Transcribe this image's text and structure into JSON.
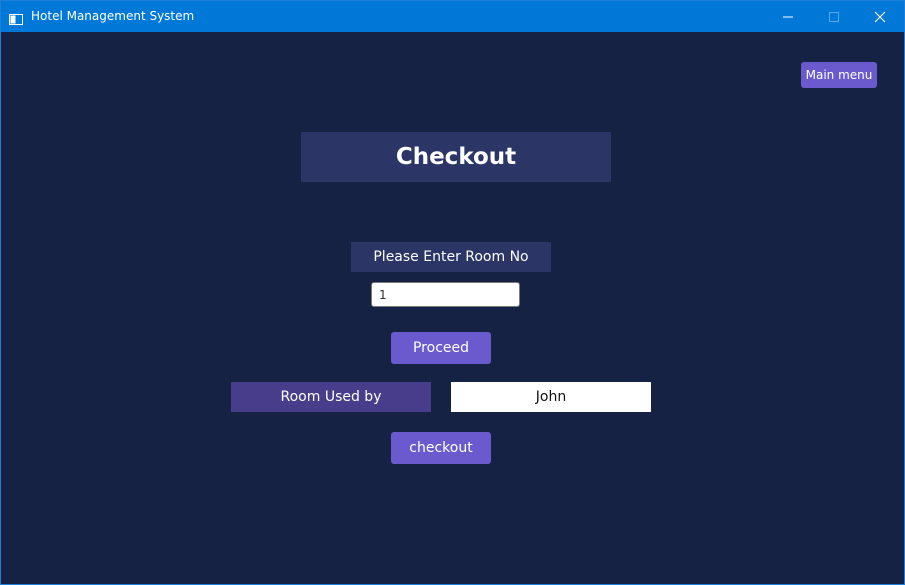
{
  "window": {
    "title": "Hotel Management System",
    "icons": {
      "app": "app-window-icon",
      "minimize": "minimize-icon",
      "maximize": "maximize-icon",
      "close": "close-icon"
    }
  },
  "header": {
    "main_menu_label": "Main menu",
    "title": "Checkout"
  },
  "form": {
    "room_prompt": "Please Enter Room No",
    "room_no_value": "1",
    "proceed_label": "Proceed",
    "used_by_label": "Room Used by",
    "used_by_value": "John",
    "checkout_label": "checkout"
  },
  "colors": {
    "titlebar": "#0078d7",
    "background": "#152244",
    "panel": "#2b3566",
    "accent": "#6a5acd",
    "label_dark": "#483d8b"
  }
}
